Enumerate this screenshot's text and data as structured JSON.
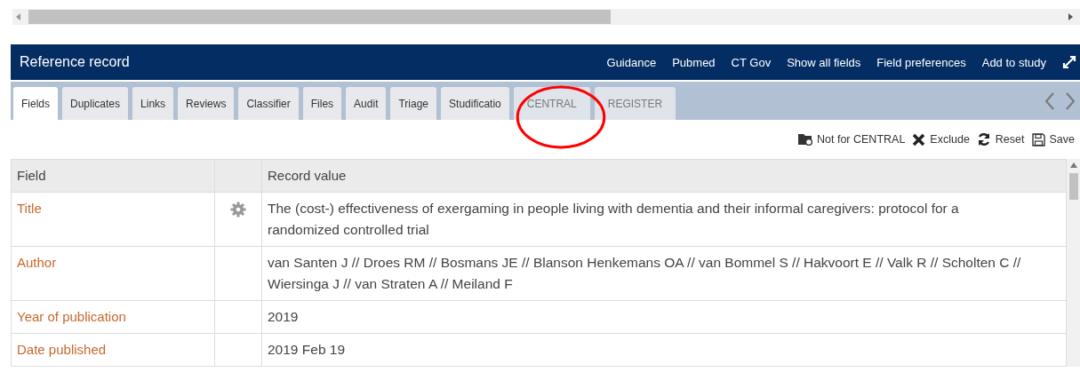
{
  "header": {
    "title": "Reference record",
    "links": [
      "Guidance",
      "Pubmed",
      "CT Gov",
      "Show all fields",
      "Field preferences",
      "Add to study"
    ]
  },
  "tabs": [
    {
      "label": "Fields",
      "selected": true,
      "disabled": false
    },
    {
      "label": "Duplicates",
      "selected": false,
      "disabled": false
    },
    {
      "label": "Links",
      "selected": false,
      "disabled": false
    },
    {
      "label": "Reviews",
      "selected": false,
      "disabled": false
    },
    {
      "label": "Classifier",
      "selected": false,
      "disabled": false
    },
    {
      "label": "Files",
      "selected": false,
      "disabled": false
    },
    {
      "label": "Audit",
      "selected": false,
      "disabled": false
    },
    {
      "label": "Triage",
      "selected": false,
      "disabled": false
    },
    {
      "label": "Studificatio",
      "selected": false,
      "disabled": false
    },
    {
      "label": "CENTRAL",
      "selected": false,
      "disabled": true
    },
    {
      "label": "REGISTER",
      "selected": false,
      "disabled": true
    }
  ],
  "actions": [
    {
      "kind": "notfor",
      "label": "Not for CENTRAL"
    },
    {
      "kind": "exclude",
      "label": "Exclude"
    },
    {
      "kind": "reset",
      "label": "Reset"
    },
    {
      "kind": "save",
      "label": "Save"
    }
  ],
  "table": {
    "columns": [
      "Field",
      "Record value"
    ],
    "rows": [
      {
        "field": "Title",
        "settings": true,
        "value": "The (cost-) effectiveness of exergaming in people living with dementia and their informal caregivers: protocol for a randomized controlled trial"
      },
      {
        "field": "Author",
        "settings": false,
        "value": "van Santen J // Droes RM // Bosmans JE // Blanson Henkemans OA // van Bommel S // Hakvoort E // Valk R // Scholten C // Wiersinga J // van Straten A // Meiland F"
      },
      {
        "field": "Year of publication",
        "settings": false,
        "value": "2019"
      },
      {
        "field": "Date published",
        "settings": false,
        "value": "2019 Feb 19"
      }
    ]
  }
}
